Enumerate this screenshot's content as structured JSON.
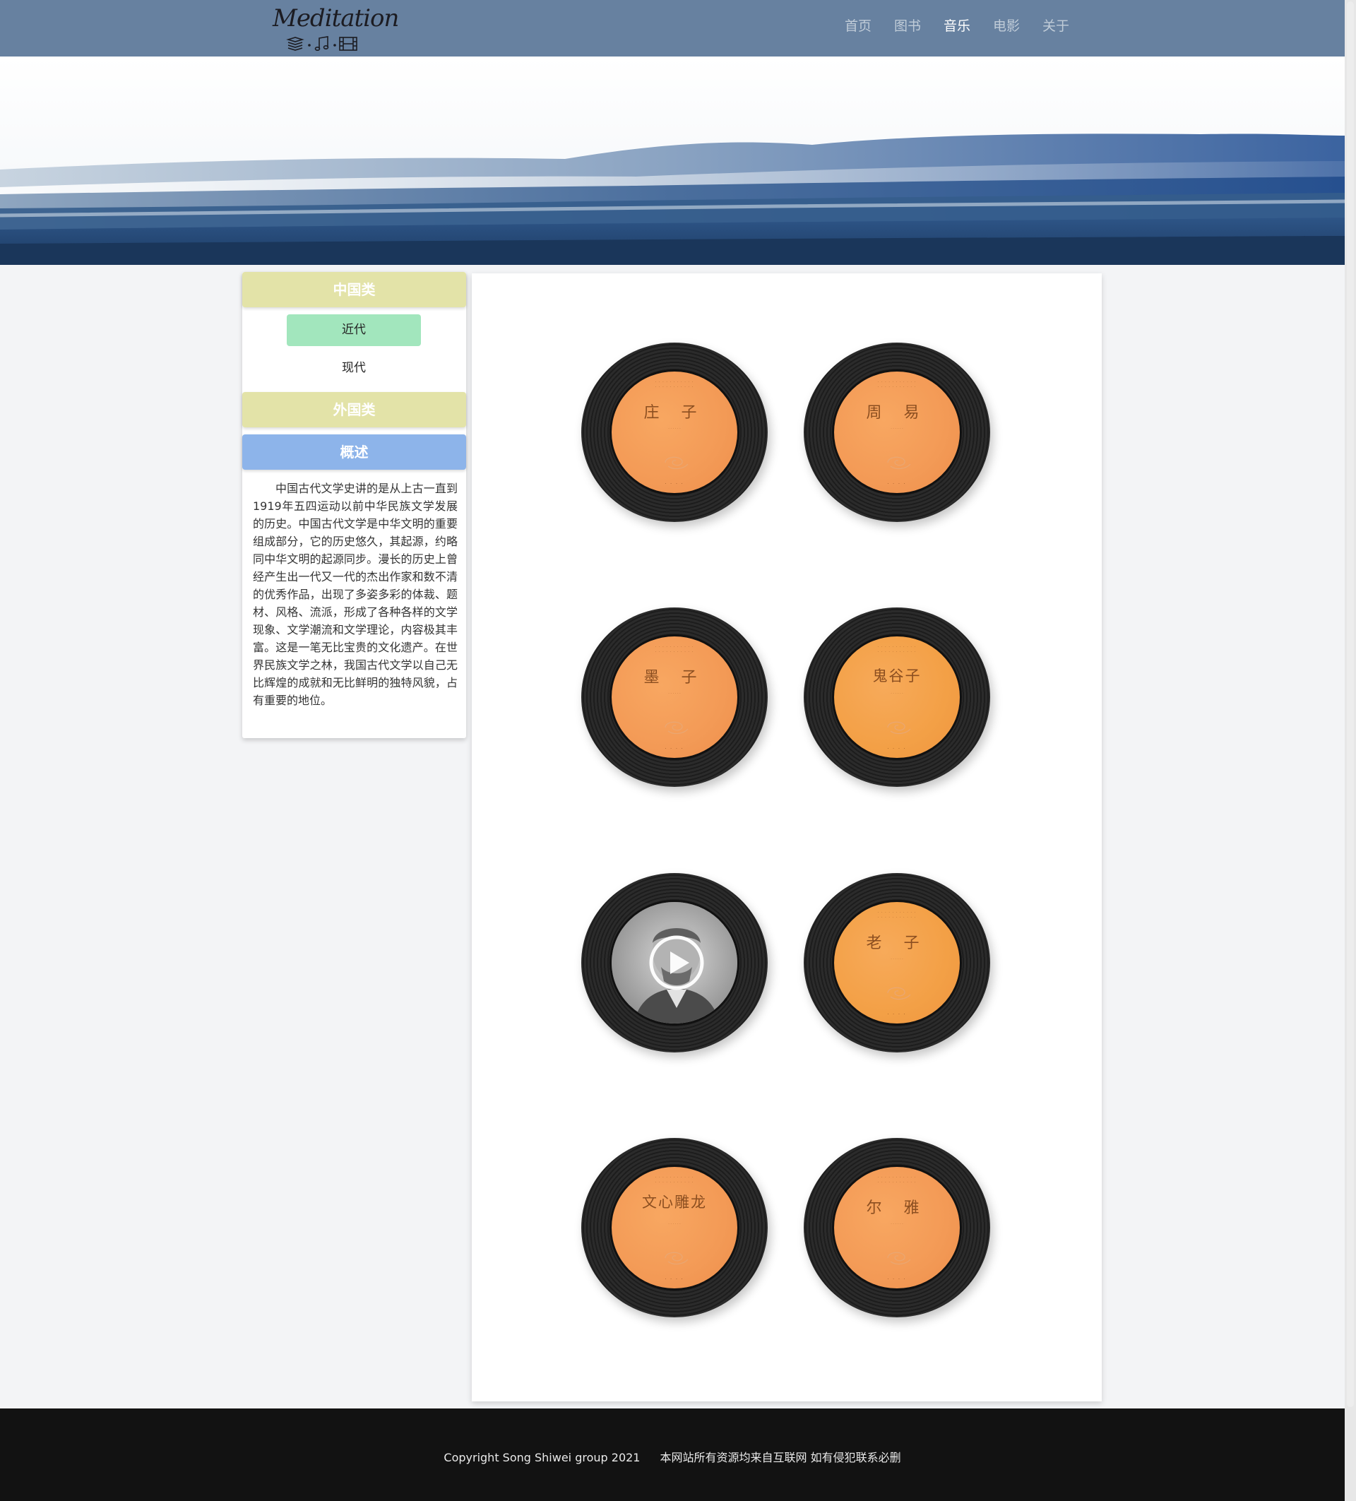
{
  "brand": {
    "logo_text": "Meditation",
    "logo_icons": [
      "book-stack-icon",
      "music-note-icon",
      "film-icon"
    ]
  },
  "nav": {
    "items": [
      {
        "label": "首页",
        "active": false
      },
      {
        "label": "图书",
        "active": false
      },
      {
        "label": "音乐",
        "active": true
      },
      {
        "label": "电影",
        "active": false
      },
      {
        "label": "关于",
        "active": false
      }
    ]
  },
  "sidebar": {
    "china_category": "中国类",
    "sub_items": [
      {
        "label": "近代",
        "active": true
      },
      {
        "label": "现代",
        "active": false
      }
    ],
    "foreign_category": "外国类",
    "overview_title": "概述",
    "overview_text": "中国古代文学史讲的是从上古一直到1919年五四运动以前中华民族文学发展的历史。中国古代文学是中华文明的重要组成部分，它的历史悠久，其起源，约略同中华文明的起源同步。漫长的历史上曾经产生出一代又一代的杰出作家和数不清的优秀作品，出现了多姿多彩的体裁、题材、风格、流派，形成了各种各样的文学现象、文学潮流和文学理论，内容极其丰富。这是一笔无比宝贵的文化遗产。在世界民族文学之林，我国古代文学以自己无比辉煌的成就和无比鲜明的独特风貌，占有重要的地位。"
  },
  "records": [
    {
      "title": "庄 子"
    },
    {
      "title": "周 易"
    },
    {
      "title": "墨 子"
    },
    {
      "title": "鬼谷子"
    },
    {
      "title": ""
    },
    {
      "title": "老 子"
    },
    {
      "title": "文心雕龙"
    },
    {
      "title": "尔 雅"
    }
  ],
  "footer": {
    "copyright": "Copyright Song Shiwei group 2021",
    "notice": "本网站所有资源均来自互联网 如有侵犯联系必删"
  },
  "colors": {
    "header": "#6781a0",
    "category_yellow": "#e3e3a8",
    "active_green": "#a2e6bd",
    "overview_blue": "#8db4ea",
    "label_orange": "#f39a56",
    "footer": "#121212"
  }
}
